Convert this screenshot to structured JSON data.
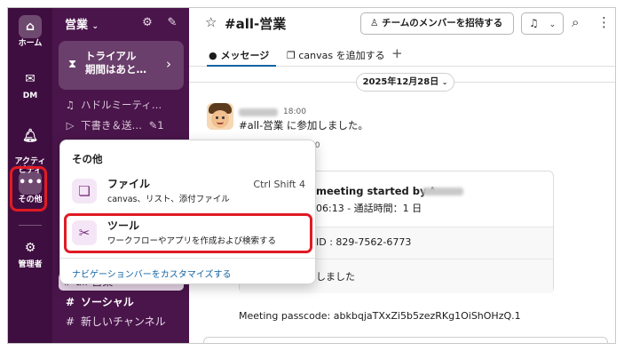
{
  "rail": {
    "home_label": "ホーム",
    "dm_label": "DM",
    "activity_label": "アクティ\nビティ",
    "more_label": "その他",
    "admin_label": "管理者"
  },
  "sidebar": {
    "workspace_name": "営業",
    "trial_text": "トライアル\n期間はあと…",
    "rows": [
      {
        "icon": "headphones-icon",
        "label": "ハドルミーティ…"
      },
      {
        "icon": "send-icon",
        "label": "下書き＆送…",
        "badge": "1"
      }
    ],
    "channels": [
      {
        "label": "all-営業",
        "active": true
      },
      {
        "label": "ソーシャル",
        "bold": true
      },
      {
        "label": "新しいチャンネル"
      }
    ]
  },
  "header": {
    "channel_title": "#all-営業",
    "invite_label": "チームのメンバーを招待する"
  },
  "tabs": {
    "messages": "メッセージ",
    "canvas": "canvas を追加する"
  },
  "date_divider": "2025年12月28日",
  "message": {
    "time": "18:00",
    "text": "#all-営業 に参加しました。",
    "time2": "10"
  },
  "meeting": {
    "title": "meeting started by",
    "subtitle": "06:13 - 通話時間：1 日",
    "meeting_id": "ID : 829-7562-6773",
    "ended": "しました",
    "passcode": "Meeting passcode: abkbqjaTXxZi5b5zezRKg1OiShOHzQ.1"
  },
  "popup": {
    "title": "その他",
    "items": [
      {
        "icon": "file-icon",
        "label": "ファイル",
        "desc": "canvas、リスト、添付ファイル",
        "shortcut": "Ctrl Shift 4"
      },
      {
        "icon": "tools-icon",
        "label": "ツール",
        "desc": "ワークフローやアプリを作成および検索する",
        "shortcut": ""
      }
    ],
    "customize_link": "ナビゲーションバーをカスタマイズする"
  },
  "colors": {
    "rail_bg": "#3f0e40",
    "sidebar_bg": "#4a154b",
    "highlight_red": "#e01b24",
    "link_blue": "#1264a3"
  }
}
